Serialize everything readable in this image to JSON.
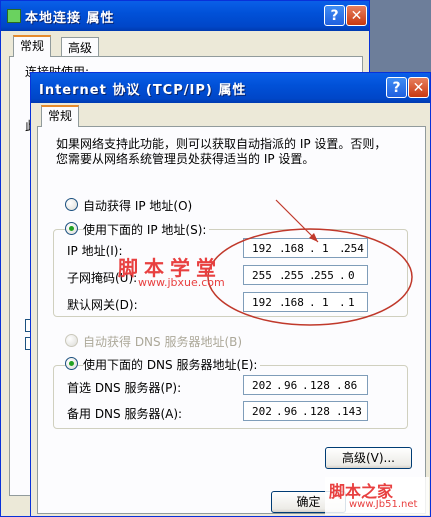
{
  "back_window": {
    "title": "本地连接 属性",
    "tabs": [
      "常规",
      "高级"
    ],
    "connect_label": "连接时使用:",
    "partial_label": "此"
  },
  "front_window": {
    "title": "Internet 协议 (TCP/IP) 属性",
    "tab": "常规",
    "description": [
      "如果网络支持此功能，则可以获取自动指派的 IP 设置。否则，",
      "您需要从网络系统管理员处获得适当的 IP 设置。"
    ],
    "ip_auto": "自动获得 IP 地址(O)",
    "ip_manual": "使用下面的 IP 地址(S):",
    "ip_label": "IP 地址(I):",
    "mask_label": "子网掩码(U):",
    "gateway_label": "默认网关(D):",
    "ip_octets": [
      "192",
      "168",
      "1",
      "254"
    ],
    "mask_octets": [
      "255",
      "255",
      "255",
      "0"
    ],
    "gateway_octets": [
      "192",
      "168",
      "1",
      "1"
    ],
    "dns_auto": "自动获得 DNS 服务器地址(B)",
    "dns_manual": "使用下面的 DNS 服务器地址(E):",
    "dns_pref_label": "首选 DNS 服务器(P):",
    "dns_alt_label": "备用 DNS 服务器(A):",
    "dns_pref_octets": [
      "202",
      "96",
      "128",
      "86"
    ],
    "dns_alt_octets": [
      "202",
      "96",
      "128",
      "143"
    ],
    "advanced_button": "高级(V)...",
    "ok_button": "确定"
  },
  "watermarks": {
    "site_cn": "脚本学堂",
    "site_url": "www.jbxue.com",
    "corner_cn": "脚本之家",
    "corner_url": "www.Jb51.net"
  },
  "colors": {
    "titlebar": "#0054e3",
    "annotation": "#c0392b",
    "watermark": "#e84040"
  }
}
